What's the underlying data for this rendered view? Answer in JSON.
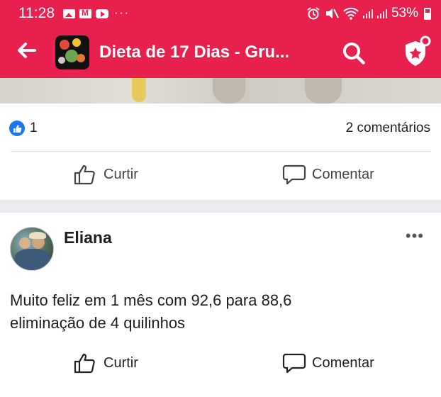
{
  "status_bar": {
    "time": "11:28",
    "notification_icons": [
      "image-icon",
      "mail-icon",
      "youtube-icon"
    ],
    "more": "···",
    "battery": "53%"
  },
  "app_bar": {
    "title": "Dieta de 17 Dias - Gru...",
    "back_icon": "arrow-left-icon",
    "search_icon": "search-icon",
    "admin_icon": "shield-star-icon"
  },
  "post1": {
    "reaction_count": "1",
    "comments": "2 comentários",
    "like_label": "Curtir",
    "comment_label": "Comentar"
  },
  "post2": {
    "author": "Eliana",
    "more": "•••",
    "text_lines": [
      "Muito feliz em 1 mês com 92,6 para 88,6",
      "eliminação de 4 quilinhos"
    ],
    "like_label": "Curtir",
    "comment_label": "Comentar"
  },
  "colors": {
    "accent": "#e8204d",
    "like_blue": "#1877f2"
  }
}
